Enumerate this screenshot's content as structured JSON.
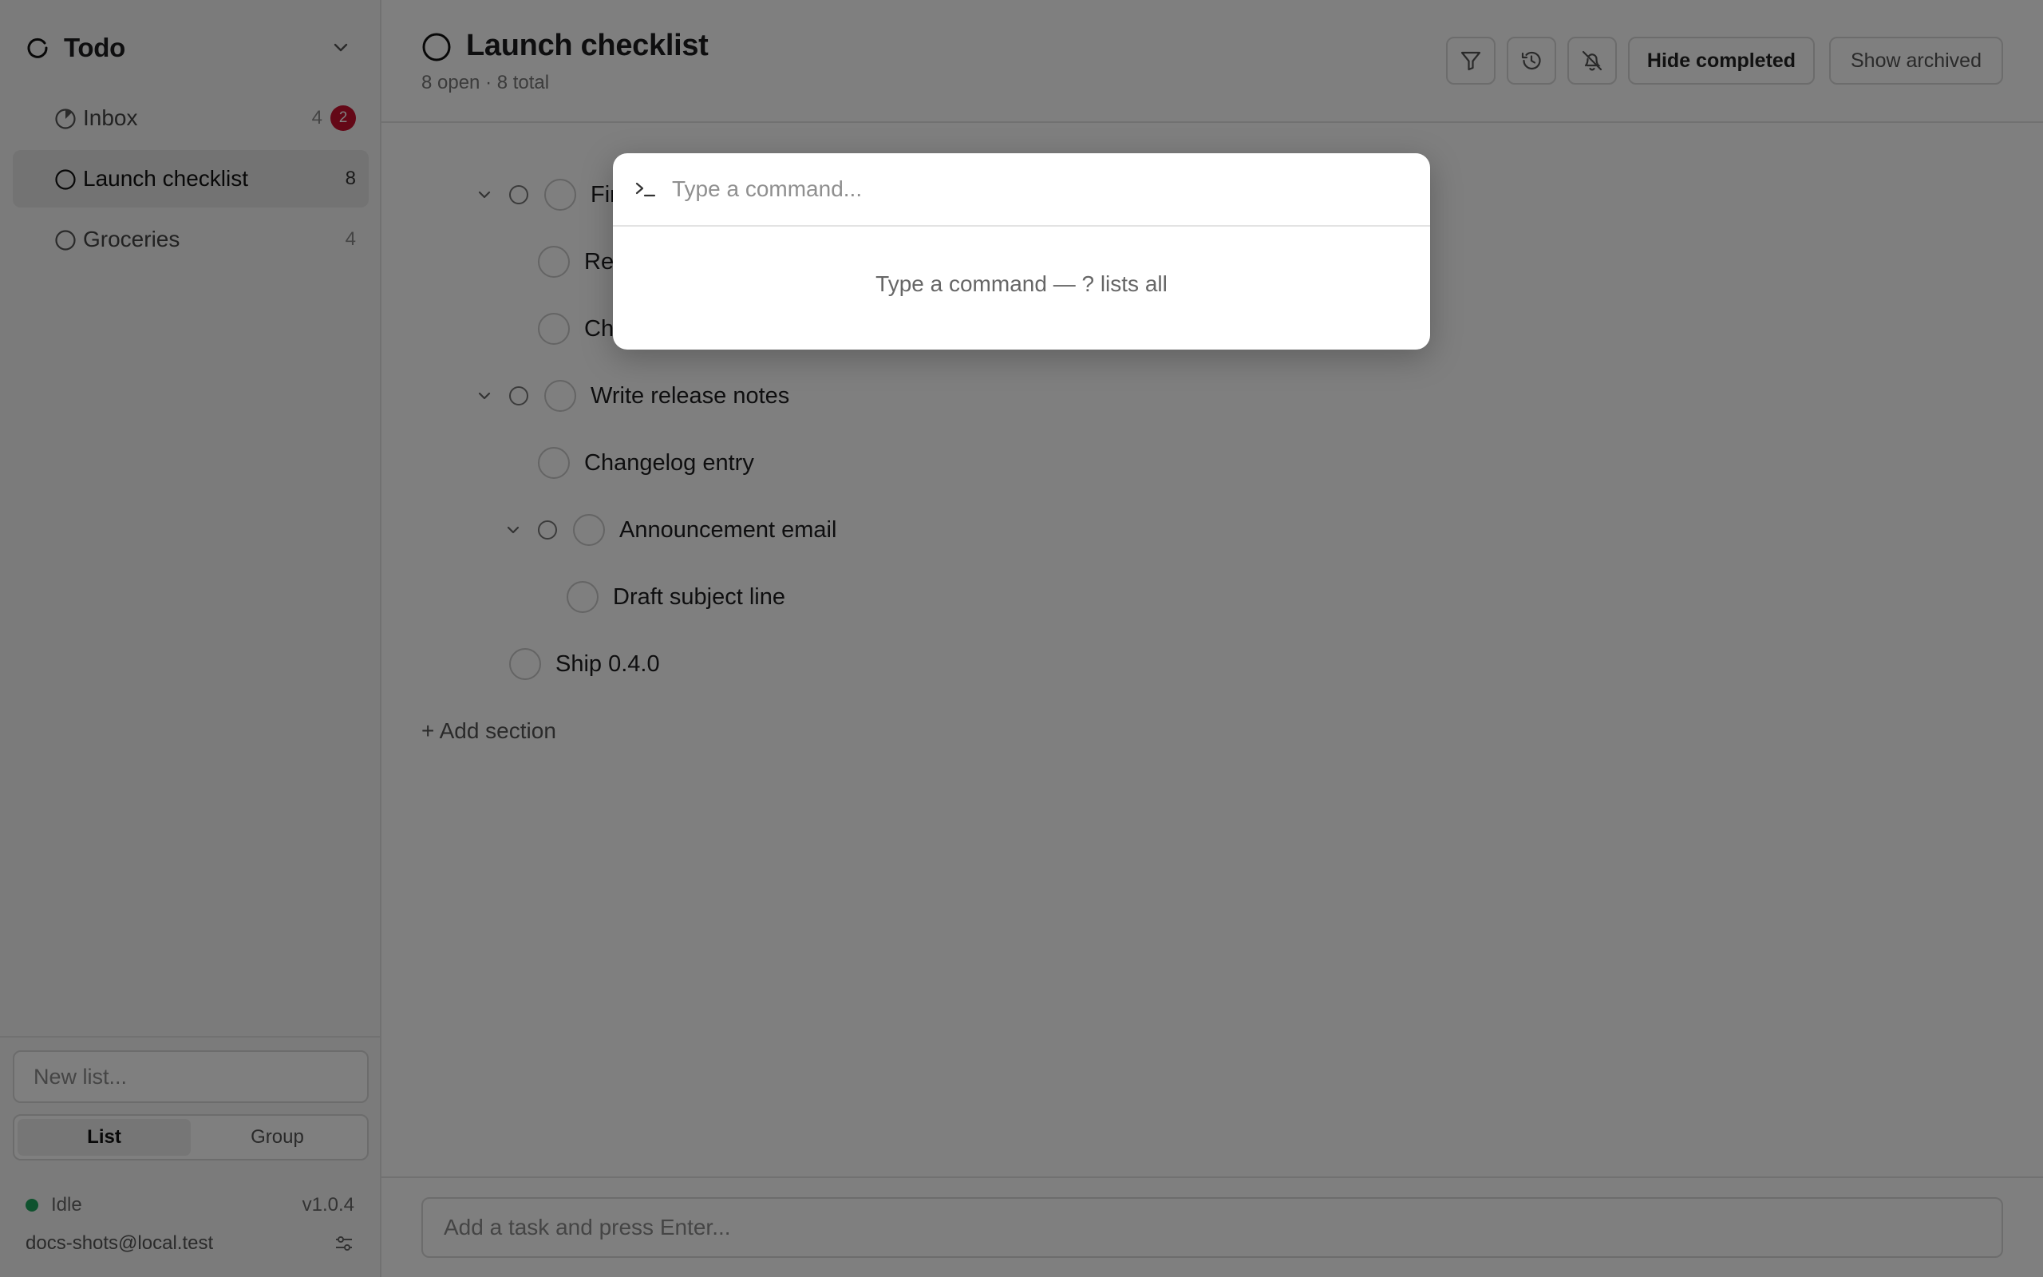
{
  "sidebar": {
    "app_title": "Todo",
    "lists": [
      {
        "label": "Inbox",
        "count": "4",
        "badge": "2",
        "icon": "pie-progress-icon"
      },
      {
        "label": "Launch checklist",
        "count": "8",
        "icon": "circle-icon"
      },
      {
        "label": "Groceries",
        "count": "4",
        "icon": "circle-icon"
      }
    ],
    "new_list_placeholder": "New list...",
    "view_toggle": {
      "list": "List",
      "group": "Group",
      "selected": "List"
    },
    "status": {
      "text": "Idle",
      "version": "v1.0.4",
      "color": "#1fa45c"
    },
    "user_email": "docs-shots@local.test"
  },
  "main": {
    "title": "Launch checklist",
    "subtitle": "8 open · 8 total",
    "toolbar": {
      "filter_icon": "filter-icon",
      "history_icon": "history-icon",
      "mute_icon": "bell-off-icon",
      "hide_completed": "Hide completed",
      "show_archived": "Show archived"
    },
    "tasks": [
      {
        "title": "Fin",
        "level": 0,
        "collapsible": true
      },
      {
        "title": "Rev",
        "level": 1,
        "collapsible": false
      },
      {
        "title": "Ch",
        "level": 1,
        "collapsible": false
      },
      {
        "title": "Write release notes",
        "level": 0,
        "collapsible": true
      },
      {
        "title": "Changelog entry",
        "level": 1,
        "collapsible": false
      },
      {
        "title": "Announcement email",
        "level": 1,
        "collapsible": true
      },
      {
        "title": "Draft subject line",
        "level": 2,
        "collapsible": false
      },
      {
        "title": "Ship 0.4.0",
        "level": 0,
        "collapsible": false
      }
    ],
    "add_section": "+ Add section",
    "add_task_placeholder": "Add a task and press Enter..."
  },
  "command_palette": {
    "placeholder": "Type a command...",
    "hint": "Type a command — ? lists all"
  },
  "colors": {
    "badge": "#c8102e",
    "overlay": "rgba(0,0,0,0.5)"
  }
}
